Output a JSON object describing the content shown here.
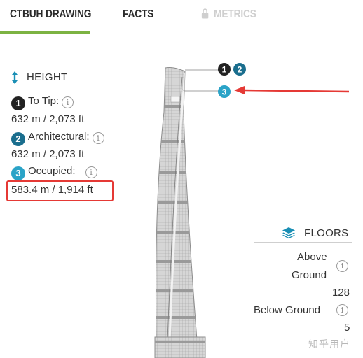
{
  "tabs": [
    {
      "label": "CTBUH DRAWING",
      "state": "active"
    },
    {
      "label": "FACTS",
      "state": "inactive"
    },
    {
      "label": "METRICS",
      "state": "disabled"
    }
  ],
  "colors": {
    "tab_underline": "#7cb342",
    "badge_dark": "#222222",
    "badge_teal": "#1a6e8e",
    "badge_cyan": "#2aa3c7",
    "highlight": "#e53935",
    "annotation_arrow": "#e53935"
  },
  "height": {
    "title": "HEIGHT",
    "icon": "vertical-arrows-icon",
    "items": [
      {
        "badge": "1",
        "label": "To Tip:",
        "value": "632 m / 2,073 ft"
      },
      {
        "badge": "2",
        "label": "Architectural:",
        "value": "632 m / 2,073 ft"
      },
      {
        "badge": "3",
        "label": "Occupied:",
        "value": "583.4 m / 1,914 ft"
      }
    ]
  },
  "drawing": {
    "markers": [
      "1",
      "2",
      "3"
    ]
  },
  "floors": {
    "title": "FLOORS",
    "icon": "stack-layers-icon",
    "above_line1": "Above",
    "above_line2": "Ground",
    "above_value": "128",
    "below_label": "Below Ground",
    "below_value": "5"
  },
  "watermark": "知乎用户"
}
